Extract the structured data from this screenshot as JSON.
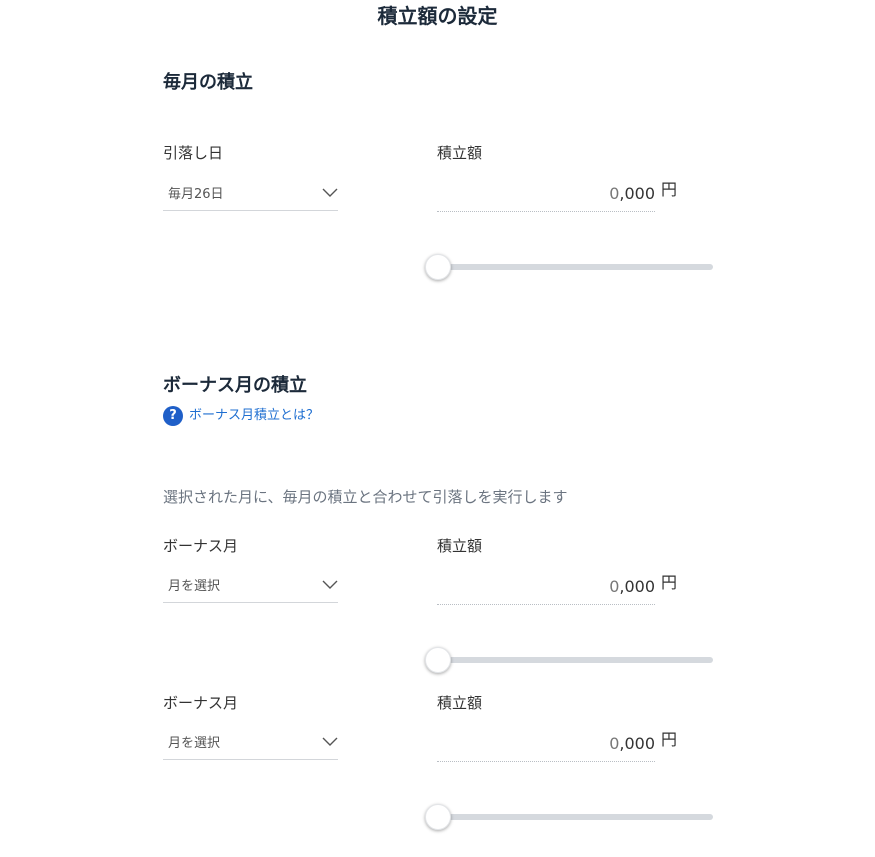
{
  "page": {
    "title": "積立額の設定"
  },
  "monthly": {
    "section_title": "毎月の積立",
    "date_label": "引落し日",
    "date_value": "毎月26日",
    "amount_label": "積立額",
    "amount_placeholder_zero": "0",
    "amount_placeholder_rest": ",000",
    "amount_unit": "円",
    "slider_level": 0
  },
  "bonus": {
    "section_title": "ボーナス月の積立",
    "help_link": "ボーナス月積立とは？",
    "help_icon_glyph": "?",
    "note": "選択された月に、毎月の積立と合わせて引落しを実行します",
    "rows": [
      {
        "month_label": "ボーナス月",
        "month_value": "月を選択",
        "amount_label": "積立額",
        "amount_placeholder_zero": "0",
        "amount_placeholder_rest": ",000",
        "amount_unit": "円",
        "slider_level": 0
      },
      {
        "month_label": "ボーナス月",
        "month_value": "月を選択",
        "amount_label": "積立額",
        "amount_placeholder_zero": "0",
        "amount_placeholder_rest": ",000",
        "amount_unit": "円",
        "slider_level": 0
      }
    ]
  },
  "icons": {
    "select_chevron": "chevron-down-icon",
    "help": "question-circle-icon"
  },
  "colors": {
    "title": "#1c2a3a",
    "link": "#1f6fd1",
    "help_icon_bg": "#1f5fc8",
    "slider_track": "#d5d9de",
    "note_text": "#6b7480"
  }
}
